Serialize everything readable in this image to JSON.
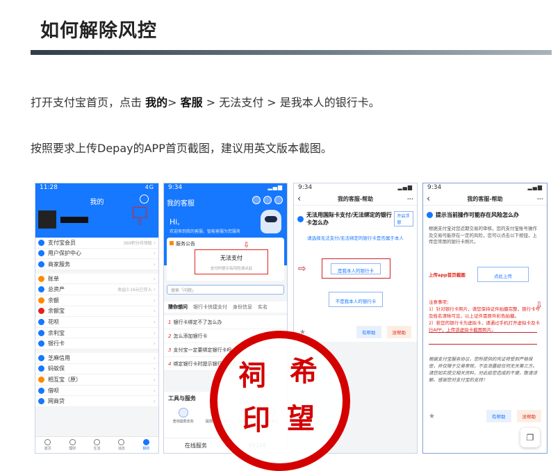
{
  "heading": "如何解除风控",
  "steps": {
    "p1_prefix": "打开支付宝首页，点击 ",
    "p1_b1": "我的",
    "p1_sep1": "> ",
    "p1_b2": "客服",
    "p1_rest": " > 无法支付 > 是我本人的银行卡。",
    "p2": "按照要求上传Depay的APP首页截图，建议用英文版本截图。"
  },
  "phone1": {
    "time": "11:28",
    "signal": "4G",
    "title": "我的",
    "rows_a": [
      {
        "label": "支付宝会员",
        "right": "369积分待领取",
        "color": "#1677ff"
      },
      {
        "label": "用户保护中心",
        "right": "",
        "color": "#1677ff"
      },
      {
        "label": "商家服务",
        "right": "",
        "color": "#1677ff"
      }
    ],
    "rows_b": [
      {
        "label": "账单",
        "right": "",
        "color": "#ff8a00"
      },
      {
        "label": "总资产",
        "right": "收益3.16元已存入",
        "color": "#1677ff"
      },
      {
        "label": "余额",
        "right": "",
        "color": "#ff8a00"
      },
      {
        "label": "余额宝",
        "right": "",
        "color": "#e0221a"
      },
      {
        "label": "花呗",
        "right": "",
        "color": "#1677ff"
      },
      {
        "label": "余利宝",
        "right": "",
        "color": "#1677ff"
      },
      {
        "label": "银行卡",
        "right": "",
        "color": "#1677ff"
      }
    ],
    "rows_c": [
      {
        "label": "芝麻信用",
        "right": "",
        "color": "#1677ff"
      },
      {
        "label": "蚂蚁保",
        "right": "",
        "color": "#1677ff"
      },
      {
        "label": "相互宝（原）",
        "right": "",
        "color": "#ff8a00"
      },
      {
        "label": "借呗",
        "right": "",
        "color": "#1677ff"
      },
      {
        "label": "网商贷",
        "right": "",
        "color": "#1677ff"
      }
    ],
    "tabs": [
      "首页",
      "理财",
      "生活",
      "消息",
      "我的"
    ]
  },
  "phone2": {
    "time": "9:34",
    "title": "我的客服",
    "greeting": "Hi,",
    "greeting_sub": "欢迎来到我的客服，智能客服为您服务",
    "notice": "服务公告",
    "boxed_title": "无法支付",
    "boxed_sub": "支付时提示有风险请点此",
    "search_placeholder": "搜索「问题」",
    "faq_tabs": [
      "猜你想问",
      "银行卡快捷支付",
      "身份信息",
      "实名"
    ],
    "faqs": [
      {
        "n": "1",
        "q": "银行卡绑定不了怎么办"
      },
      {
        "n": "2",
        "q": "怎么添加银行卡"
      },
      {
        "n": "3",
        "q": "支付宝一定要绑定银行卡吗"
      },
      {
        "n": "4",
        "q": "绑定银行卡时提示银行卡不支持怎么办"
      }
    ],
    "tools_title": "工具与服务",
    "tools": [
      "查询退款去向",
      "提现到账查询",
      "交易举报",
      "联系我们"
    ],
    "bottom_left": "在线服务",
    "bottom_right": "95188"
  },
  "phone3": {
    "time": "9:34",
    "header": "我的客服-帮助",
    "question": "无法用国际卡支付/无法绑定的银行卡怎么办",
    "tag": "开启浮窗",
    "instruction": "请选择无法支付/无法绑定的银行卡是否属于本人",
    "btn_mine": "是我本人的银行卡",
    "btn_not_mine": "不是我本人的银行卡",
    "helpful": "有帮助",
    "unhelpful": "没帮助"
  },
  "phone4": {
    "time": "9:34",
    "header": "我的客服-帮助",
    "question": "提示当前操作可能存在风险怎么办",
    "body": "根据支付宝对您近期交易的审核，您的支付宝账号操作及交易可能存在一定的风险，您可以点击以下按钮，上传您常用的银行卡照片。",
    "upload_label": "上传app首页截图",
    "upload_btn": "点此上传",
    "notes_title": "注意事项：",
    "note1": "1）针对银行卡照片，请您保持证件拍摄完整，银行卡号及姓名清晰可见，以上证件需原件彩色拍摄。",
    "note2": "2）若您的银行卡为虚拟卡，请通过手机打开虚拟卡及卡行APP，上传该虚拟卡截图照片。",
    "italic": "根据支付宝服务协议，您所提供的凭证将受到严格保密，并仅限于交易审核，不会泄露给任何无关第三方。请您如实提交相关资料，对此给您造成的不便，敬请谅解。感谢您对支付宝的支持！",
    "collect": "收藏",
    "helpful": "有帮助",
    "unhelpful": "没帮助"
  },
  "stamp": [
    "祠",
    "希",
    "印",
    "望"
  ],
  "colors": {
    "alipay_blue": "#1677ff",
    "annotation_red": "#e0221a",
    "seal_red": "#d40000"
  }
}
